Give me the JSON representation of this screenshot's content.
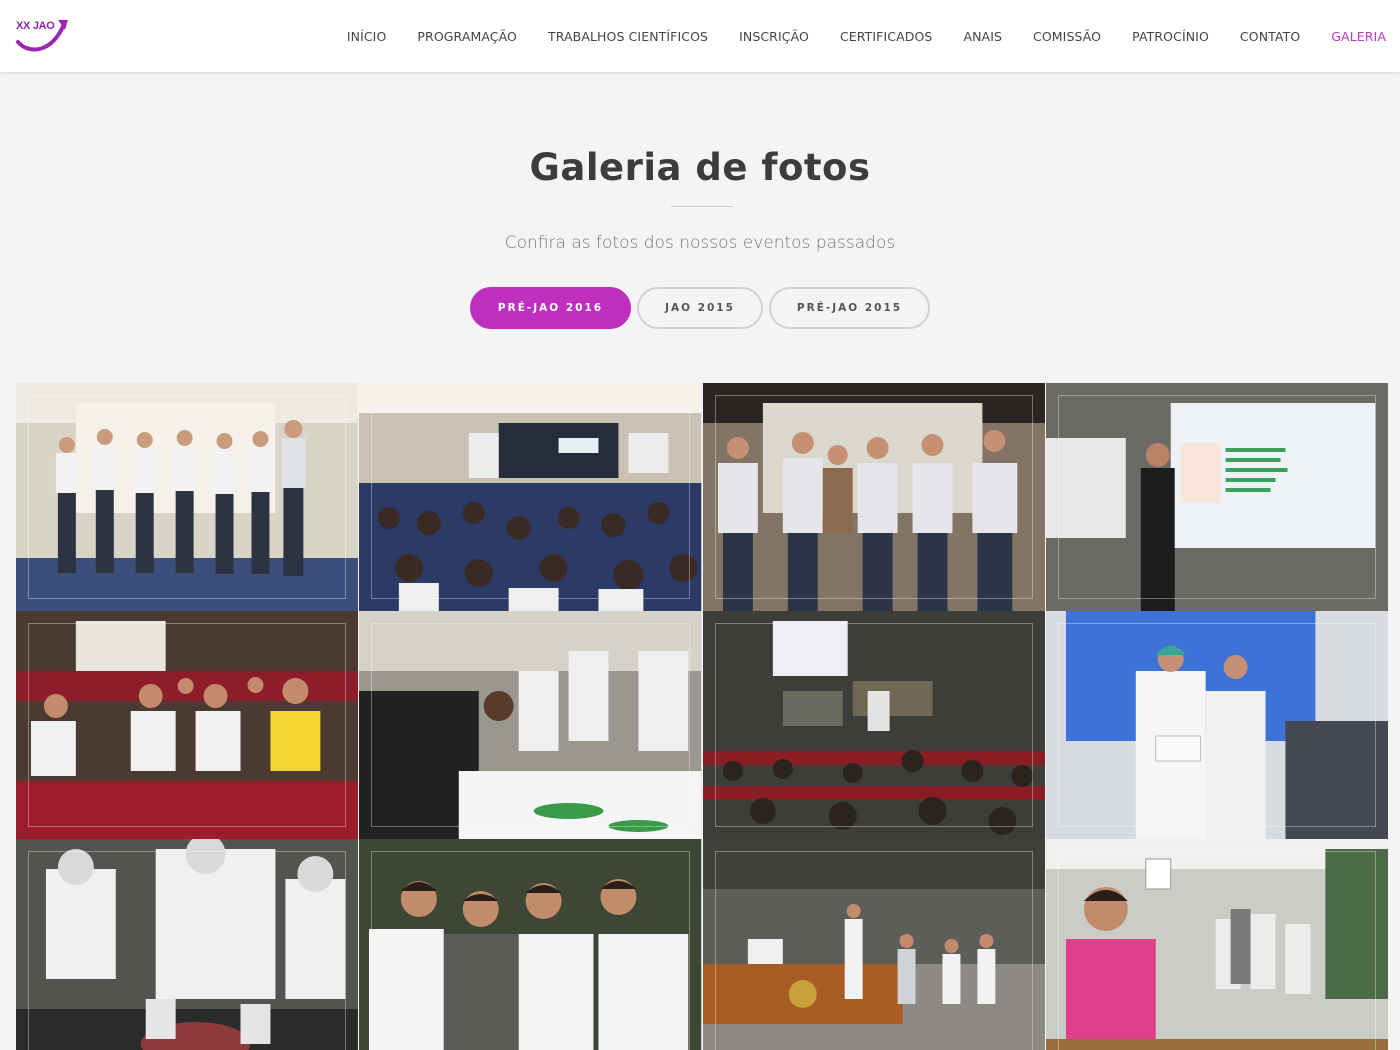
{
  "brand": {
    "logo_text": "XX JAO",
    "accent": "#c02ec0"
  },
  "nav": {
    "items": [
      {
        "label": "INÍCIO"
      },
      {
        "label": "PROGRAMAÇÃO"
      },
      {
        "label": "TRABALHOS CIENTÍFICOS"
      },
      {
        "label": "INSCRIÇÃO"
      },
      {
        "label": "CERTIFICADOS"
      },
      {
        "label": "ANAIS"
      },
      {
        "label": "COMISSÃO"
      },
      {
        "label": "PATROCÍNIO"
      },
      {
        "label": "CONTATO"
      },
      {
        "label": "GALERIA"
      }
    ],
    "active": "GALERIA"
  },
  "hero": {
    "title": "Galeria de fotos",
    "subtitle": "Confira as fotos dos nossos eventos passados"
  },
  "filters": [
    {
      "label": "PRÉ-JAO 2016"
    },
    {
      "label": "JAO 2015"
    },
    {
      "label": "PRÉ-JAO 2015"
    }
  ],
  "active_filter": "PRÉ-JAO 2016",
  "gallery": {
    "photos": [
      {
        "scene": "group-standing"
      },
      {
        "scene": "auditorium-audience"
      },
      {
        "scene": "group-standing"
      },
      {
        "scene": "speaker-projection"
      },
      {
        "scene": "seated-audience"
      },
      {
        "scene": "registration-desk"
      },
      {
        "scene": "auditorium-audience"
      },
      {
        "scene": "certificate-handover"
      },
      {
        "scene": "hands-on-lab"
      },
      {
        "scene": "group-standing"
      },
      {
        "scene": "auditorium-stage"
      },
      {
        "scene": "corridor-crowd"
      }
    ]
  }
}
